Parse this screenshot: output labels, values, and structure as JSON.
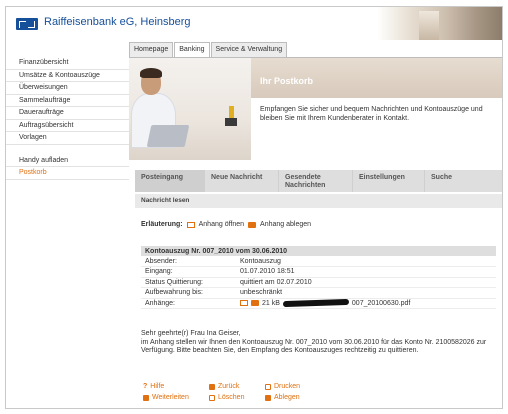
{
  "header": {
    "bank_name": "Raiffeisenbank eG, Heinsberg"
  },
  "topnav": {
    "tabs": [
      {
        "label": "Homepage"
      },
      {
        "label": "Banking"
      },
      {
        "label": "Service & Verwaltung"
      }
    ],
    "active": "Banking"
  },
  "sidebar": {
    "items": [
      {
        "label": "Finanzübersicht"
      },
      {
        "label": "Umsätze & Kontoauszüge"
      },
      {
        "label": "Überweisungen"
      },
      {
        "label": "Sammelaufträge"
      },
      {
        "label": "Daueraufträge"
      },
      {
        "label": "Auftragsübersicht"
      },
      {
        "label": "Vorlagen"
      }
    ],
    "items2": [
      {
        "label": "Handy aufladen"
      },
      {
        "label": "Postkorb"
      }
    ],
    "active": "Postkorb",
    "active_color": "#e07010"
  },
  "banner": {
    "title": "Ihr Postkorb",
    "text": "Empfangen Sie sicher und bequem Nachrichten und Kontoauszüge und bleiben Sie mit Ihrem Kundenberater in Kontakt."
  },
  "subtabs": [
    {
      "label": "Posteingang"
    },
    {
      "label": "Neue Nachricht"
    },
    {
      "label": "Gesendete Nachrichten"
    },
    {
      "label": "Einstellungen"
    },
    {
      "label": "Suche"
    }
  ],
  "section_title": "Nachricht lesen",
  "legend": {
    "label": "Erläuterung:",
    "open": "Anhang öffnen",
    "save": "Anhang ablegen"
  },
  "details": {
    "heading": "Kontoauszug Nr. 007_2010 vom 30.06.2010",
    "rows": [
      {
        "key": "Absender:",
        "value": "Kontoauszug"
      },
      {
        "key": "Eingang:",
        "value": "01.07.2010 18:51"
      },
      {
        "key": "Status Quittierung:",
        "value": "quittiert am 02.07.2010"
      },
      {
        "key": "Aufbewahrung bis:",
        "value": "unbeschränkt"
      }
    ],
    "attachment_key": "Anhänge:",
    "attachment_size": "21 kB",
    "attachment_name_suffix": "007_20100630.pdf"
  },
  "message": {
    "greeting": "Sehr geehrte(r) Frau Ina Geiser,",
    "body": "im Anhang stellen wir Ihnen den Kontoauszug Nr. 007_2010 vom 30.06.2010 für das Konto Nr. 2100582026 zur Verfügung. Bitte beachten Sie, den Empfang des Kontoauszuges rechtzeitig zu quittieren."
  },
  "actions": {
    "help": "Hilfe",
    "back": "Zurück",
    "print": "Drucken",
    "forward": "Weiterleiten",
    "delete": "Löschen",
    "file": "Ablegen"
  },
  "colors": {
    "brand_blue": "#16509a",
    "accent_orange": "#e07010"
  }
}
